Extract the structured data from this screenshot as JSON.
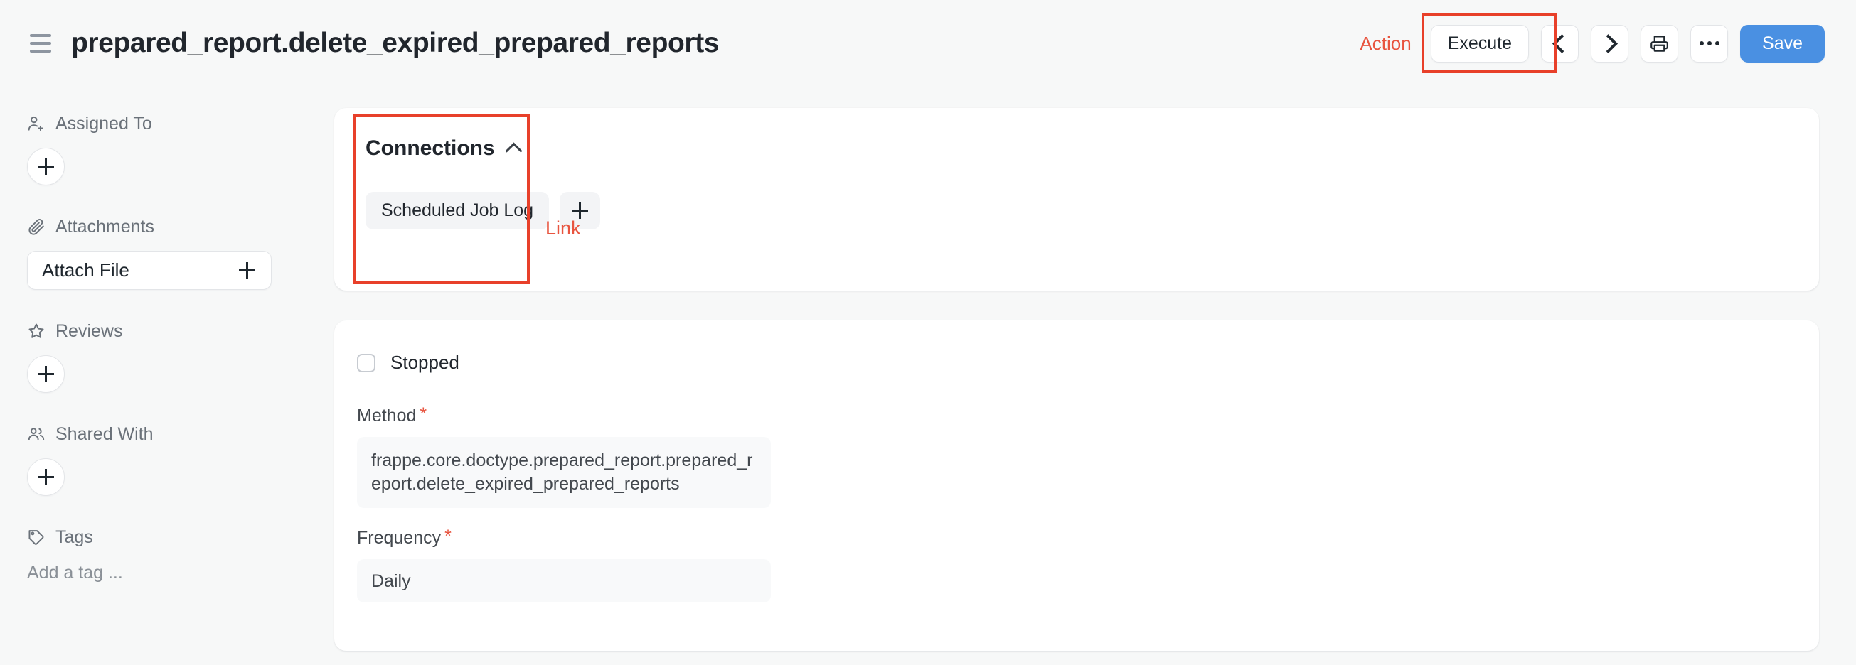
{
  "header": {
    "menu_icon": "hamburger-icon",
    "title": "prepared_report.delete_expired_prepared_reports",
    "action_label": "Action",
    "execute_label": "Execute",
    "prev_icon": "chevron-left-icon",
    "next_icon": "chevron-right-icon",
    "print_icon": "printer-icon",
    "more_icon": "ellipsis-icon",
    "save_label": "Save",
    "save_color": "#4a90e2"
  },
  "annotations": {
    "highlight_color": "#e8402a",
    "link_label": "Link",
    "link_color": "#e8543f"
  },
  "sidebar": {
    "sections": [
      {
        "label": "Assigned To",
        "icon": "user-plus-icon",
        "control": "add-button"
      },
      {
        "label": "Attachments",
        "icon": "paperclip-icon",
        "control": "attach-file-button",
        "button_label": "Attach File"
      },
      {
        "label": "Reviews",
        "icon": "star-icon",
        "control": "add-button"
      },
      {
        "label": "Shared With",
        "icon": "users-icon",
        "control": "add-button"
      },
      {
        "label": "Tags",
        "icon": "tag-icon",
        "control": "tag-input",
        "placeholder": "Add a tag ..."
      }
    ]
  },
  "connections": {
    "title": "Connections",
    "collapse_icon": "chevron-up-icon",
    "chips": [
      {
        "label": "Scheduled Job Log"
      }
    ],
    "add_icon": "plus-icon"
  },
  "form": {
    "checkbox": {
      "label": "Stopped",
      "checked": false
    },
    "fields": [
      {
        "label": "Method",
        "required": "*",
        "value": "frappe.core.doctype.prepared_report.prepared_report.delete_expired_prepared_reports",
        "multiline": true
      },
      {
        "label": "Frequency",
        "required": "*",
        "value": "Daily",
        "multiline": false
      }
    ]
  }
}
